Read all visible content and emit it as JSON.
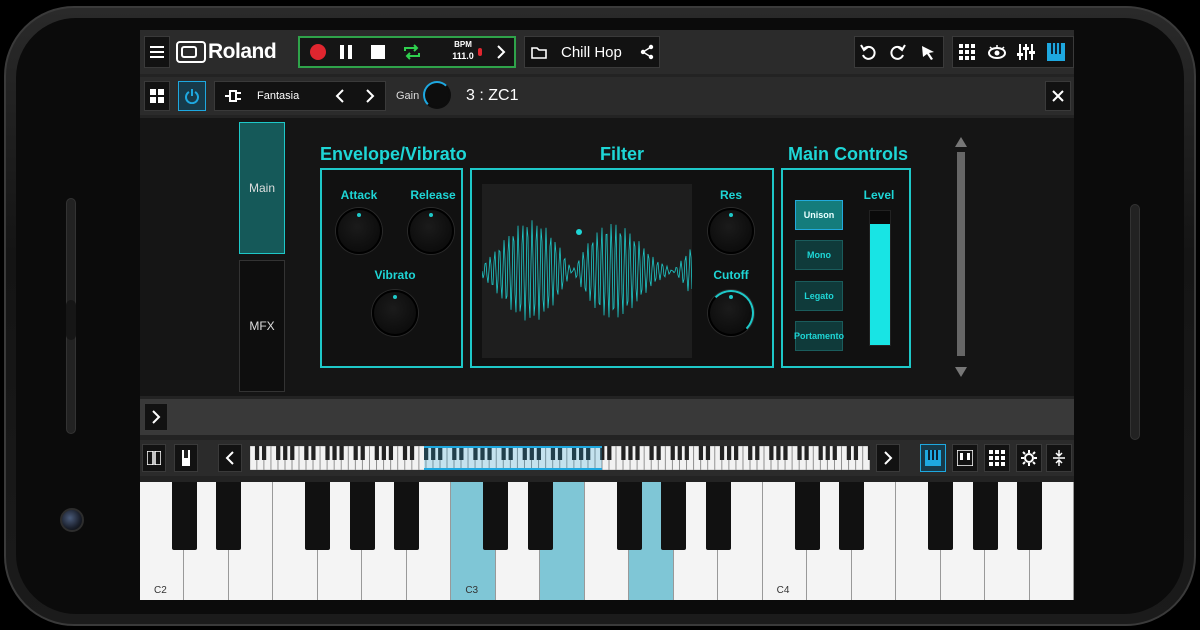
{
  "app": {
    "brand": "Roland"
  },
  "transport": {
    "bpm_label": "BPM",
    "bpm_value": "111.0"
  },
  "song": {
    "name": "Chill Hop"
  },
  "part": {
    "tone_name": "Fantasia",
    "gain_label": "Gain",
    "part_name": "3 : ZC1"
  },
  "tabs": [
    {
      "label": "Main"
    },
    {
      "label": "MFX"
    }
  ],
  "envelope": {
    "title": "Envelope/Vibrato",
    "attack": "Attack",
    "release": "Release",
    "vibrato": "Vibrato"
  },
  "filter": {
    "title": "Filter",
    "res": "Res",
    "cutoff": "Cutoff"
  },
  "main_controls": {
    "title": "Main Controls",
    "level_label": "Level",
    "level_value": 0.9,
    "buttons": [
      {
        "label": "Unison",
        "active": true
      },
      {
        "label": "Mono",
        "active": false
      },
      {
        "label": "Legato",
        "active": false
      },
      {
        "label": "Portamento",
        "active": false
      }
    ]
  },
  "keyboard": {
    "labels": [
      "C2",
      "C3",
      "C4"
    ],
    "highlighted_keys": [
      "C3",
      "E3",
      "G3"
    ]
  },
  "colors": {
    "accent": "#1ec8c8",
    "record": "#e0262f",
    "transport_border": "#2fa34a",
    "key_highlight": "#7fc6d6"
  },
  "icons": [
    "menu-icon",
    "record-icon",
    "pause-icon",
    "stop-icon",
    "loop-icon",
    "metronome-icon",
    "chevron-right-icon",
    "folder-icon",
    "share-icon",
    "undo-icon",
    "redo-icon",
    "cursor-icon",
    "grid-icon",
    "eye-icon",
    "mixer-icon",
    "piano-icon",
    "power-icon",
    "plug-icon",
    "close-icon"
  ]
}
